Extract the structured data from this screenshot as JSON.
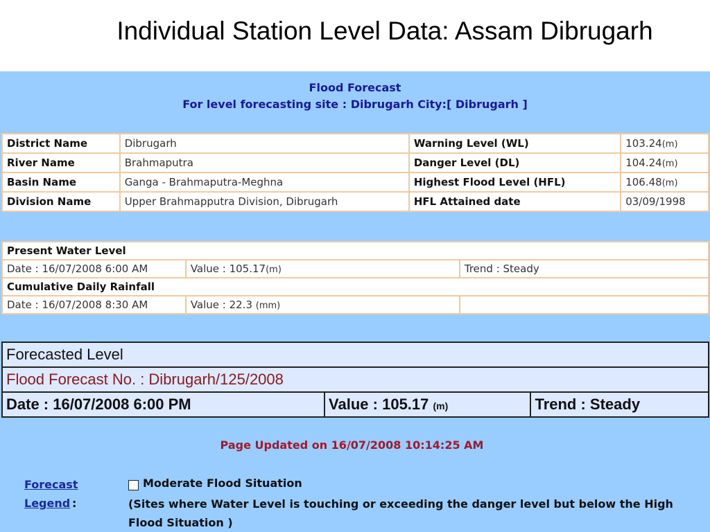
{
  "slide_title": "Individual Station Level Data: Assam Dibrugarh",
  "header": {
    "title": "Flood Forecast",
    "subtitle": "For level forecasting site : Dibrugarh City:[ Dibrugarh ]"
  },
  "station_info": [
    {
      "label": "District Name",
      "value": "Dibrugarh",
      "level_label": "Warning Level (WL)",
      "level_value": "103.24",
      "level_unit": "(m)"
    },
    {
      "label": "River Name",
      "value": "Brahmaputra",
      "level_label": "Danger Level (DL)",
      "level_value": "104.24",
      "level_unit": "(m)"
    },
    {
      "label": "Basin Name",
      "value": "Ganga - Brahmaputra-Meghna",
      "level_label": "Highest Flood Level (HFL)",
      "level_value": "106.48",
      "level_unit": "(m)"
    },
    {
      "label": "Division Name",
      "value": "Upper Brahmapputra Division, Dibrugarh",
      "level_label": "HFL Attained date",
      "level_value": "03/09/1998",
      "level_unit": ""
    }
  ],
  "present": {
    "title": "Present Water Level",
    "date": "Date :  16/07/2008 6:00 AM",
    "value_prefix": "Value :  ",
    "value": "105.17",
    "unit": "(m)",
    "trend": "Trend : Steady"
  },
  "rainfall": {
    "title": "Cumulative Daily Rainfall",
    "date": "Date :  16/07/2008 8:30 AM",
    "value_prefix": "Value :  ",
    "value": "22.3",
    "unit": "(mm)"
  },
  "forecast": {
    "title": "Forecasted Level",
    "number": "Flood Forecast No. : Dibrugarh/125/2008",
    "date": "Date :  16/07/2008 6:00 PM",
    "value_prefix": "Value :  ",
    "value": "105.17",
    "unit": "(m)",
    "trend": "Trend : Steady"
  },
  "updated": "Page Updated on 16/07/2008 10:14:25 AM",
  "legend": {
    "link_line1": "Forecast",
    "link_line2": "Legend",
    "colon": ":",
    "item_title": "Moderate Flood Situation",
    "item_desc": "(Sites where Water Level is touching or exceeding the danger level but below the High Flood Situation )"
  }
}
